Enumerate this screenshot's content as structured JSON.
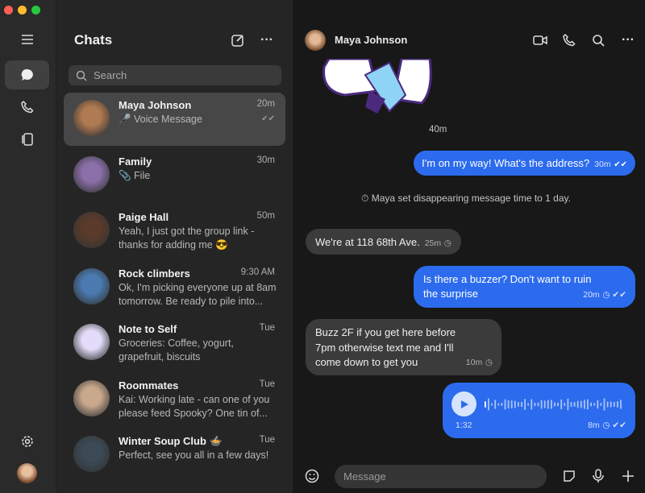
{
  "window": {
    "controls": {
      "close": "#ff5f57",
      "minimize": "#febc2e",
      "maximize": "#28c840"
    }
  },
  "rail": {
    "items": [
      "menu-icon",
      "chats-icon",
      "calls-icon",
      "stories-icon"
    ],
    "bottom": [
      "settings-icon",
      "profile-avatar"
    ]
  },
  "list": {
    "title": "Chats",
    "search_placeholder": "Search",
    "chats": [
      {
        "name": "Maya Johnson",
        "time": "20m",
        "preview": "🎤 Voice Message",
        "selected": true,
        "color": "#b07a52"
      },
      {
        "name": "Family",
        "time": "30m",
        "preview": "📎 File",
        "color": "#8a6fa8"
      },
      {
        "name": "Paige Hall",
        "time": "50m",
        "preview": "Yeah, I just got the group link - thanks for adding me 😎",
        "color": "#5a3a2a"
      },
      {
        "name": "Rock climbers",
        "time": "9:30 AM",
        "preview": "Ok, I'm picking everyone up at 8am tomorrow. Be ready to pile into...",
        "color": "#4a7ab0"
      },
      {
        "name": "Note to Self",
        "time": "Tue",
        "preview": "Groceries: Coffee, yogurt, grapefruit, biscuits",
        "color": "#e2dcf8"
      },
      {
        "name": "Roommates",
        "time": "Tue",
        "preview": "Kai: Working late - can one of you please feed Spooky? One tin of...",
        "color": "#c9a88c"
      },
      {
        "name": "Winter Soup Club 🍲",
        "time": "Tue",
        "preview": "Perfect, see you all in a few days!",
        "color": "#3b4a55"
      }
    ]
  },
  "conversation": {
    "contact": "Maya Johnson",
    "sticker_time": "40m",
    "messages": [
      {
        "dir": "out",
        "text": "I'm on my way! What's the address?",
        "time": "30m"
      },
      {
        "dir": "system",
        "text": "Maya set disappearing message time to 1 day."
      },
      {
        "dir": "in",
        "text": "We're at 118 68th Ave.",
        "time": "25m"
      },
      {
        "dir": "out",
        "text": "Is there a buzzer? Don't want to ruin the surprise",
        "time": "20m"
      },
      {
        "dir": "in",
        "text": "Buzz 2F if you get here before 7pm otherwise text me and I'll come down to get you",
        "time": "10m"
      },
      {
        "dir": "out",
        "voice_duration": "1:32",
        "time": "8m"
      }
    ],
    "composer_placeholder": "Message"
  },
  "colors": {
    "accent": "#2c6bed"
  }
}
